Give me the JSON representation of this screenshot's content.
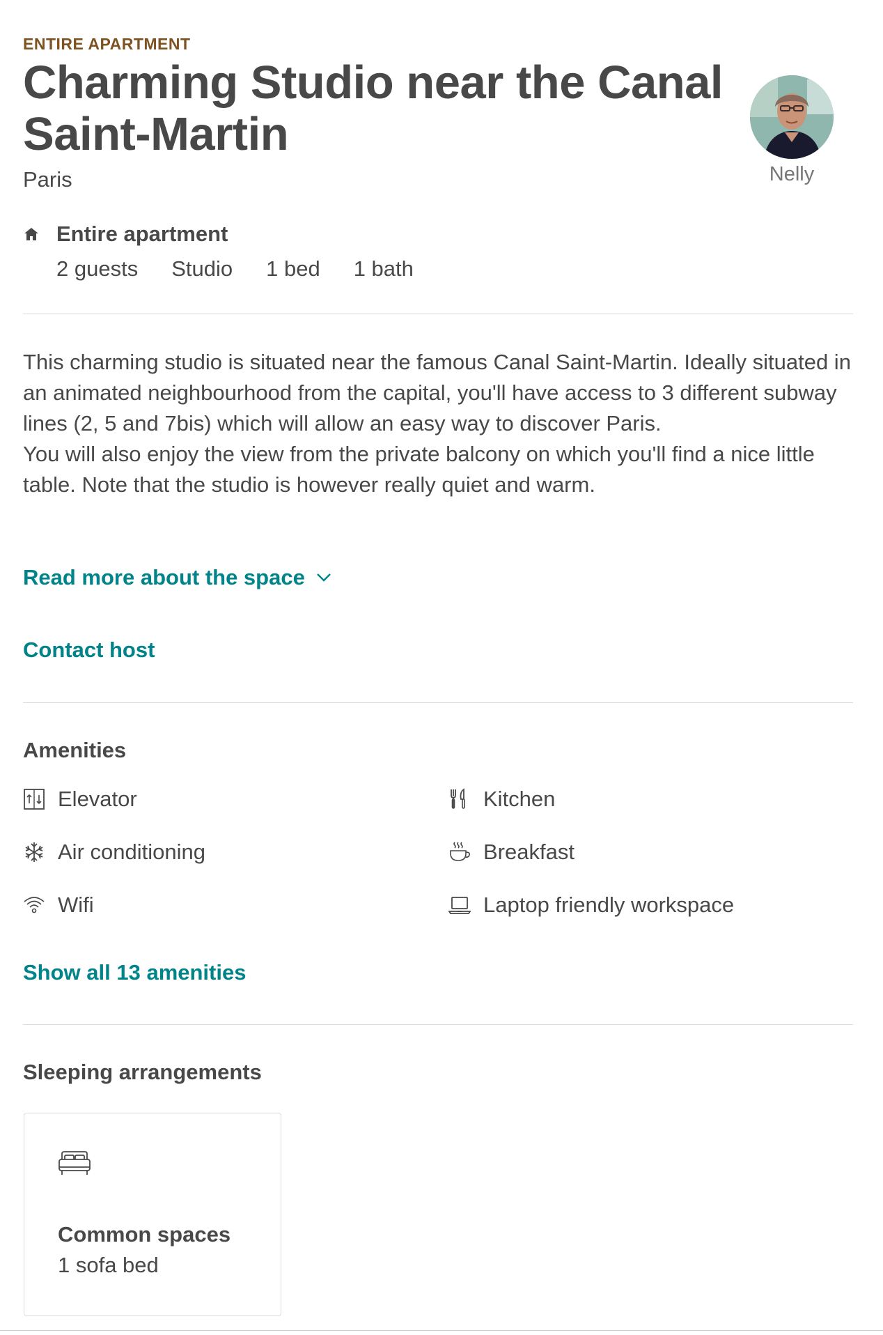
{
  "listing": {
    "kicker": "ENTIRE APARTMENT",
    "title": "Charming Studio near the Canal Saint-Martin",
    "city": "Paris"
  },
  "host": {
    "name": "Nelly"
  },
  "summary": {
    "icon": "home-icon",
    "type": "Entire apartment",
    "guests": "2 guests",
    "room_type": "Studio",
    "beds": "1 bed",
    "baths": "1 bath"
  },
  "description": {
    "paragraph_1": "This charming studio is situated near the famous Canal Saint-Martin. Ideally situated in an animated neighbourhood from the capital, you'll have access to 3 different subway lines (2, 5 and 7bis) which will allow an easy way to discover Paris.",
    "paragraph_2": "You will also enjoy the view from the private balcony on which you'll find a nice little table. Note that the studio is however really quiet and warm.",
    "read_more_label": "Read more about the space"
  },
  "contact": {
    "label": "Contact host"
  },
  "amenities": {
    "title": "Amenities",
    "items": [
      {
        "label": "Elevator",
        "icon": "elevator-icon"
      },
      {
        "label": "Kitchen",
        "icon": "kitchen-icon"
      },
      {
        "label": "Air conditioning",
        "icon": "snowflake-icon"
      },
      {
        "label": "Breakfast",
        "icon": "coffee-cup-icon"
      },
      {
        "label": "Wifi",
        "icon": "wifi-icon"
      },
      {
        "label": "Laptop friendly workspace",
        "icon": "laptop-icon"
      }
    ],
    "show_all_label": "Show all 13 amenities"
  },
  "sleeping": {
    "title": "Sleeping arrangements",
    "rooms": [
      {
        "name": "Common spaces",
        "beds": "1 sofa bed",
        "icon": "bed-icon"
      }
    ]
  },
  "colors": {
    "accent": "#008489",
    "kicker": "#7e5321",
    "text": "#484848",
    "muted": "#767676",
    "divider": "#dbdbdb"
  }
}
